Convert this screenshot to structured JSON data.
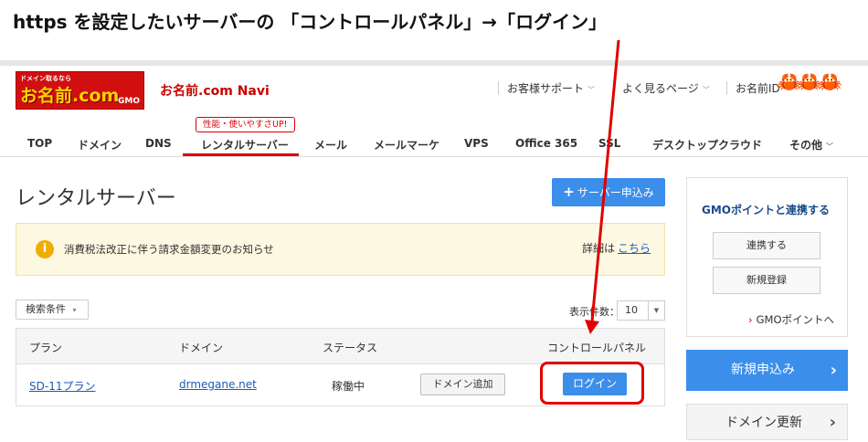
{
  "caption": "https を設定したいサーバーの 「コントロールパネル」→「ログイン」",
  "logo": {
    "tag": "ドメイン取るなら",
    "name": "お名前.com",
    "gmo": "GMO"
  },
  "header": {
    "site_name": "お名前.com Navi",
    "links": [
      "お客様サポート",
      "よく見るページ",
      "お名前ID"
    ]
  },
  "nav": {
    "badge": "性能・使いやすさUP!",
    "items": [
      "TOP",
      "ドメイン",
      "DNS",
      "レンタルサーバー",
      "メール",
      "メールマーケ",
      "VPS",
      "Office 365",
      "SSL",
      "デスクトップクラウド",
      "その他"
    ]
  },
  "main": {
    "title": "レンタルサーバー",
    "apply_button": "サーバー申込み",
    "notice": {
      "text": "消費税法改正に伴う請求金額変更のお知らせ",
      "more_label": "詳細は",
      "more_link": "こちら"
    },
    "filter_label": "検索条件",
    "per_page_label": "表示件数：",
    "per_page_value": "10"
  },
  "table": {
    "headers": [
      "プラン",
      "ドメイン",
      "ステータス",
      "コントロールパネル"
    ],
    "rows": [
      {
        "plan": "SD-11プラン",
        "domain": "drmegane.net",
        "status": "稼働中",
        "domain_add": "ドメイン追加",
        "login": "ログイン"
      }
    ]
  },
  "sidebar": {
    "title": "GMOポイントと連携する",
    "link_button": "連携する",
    "register_button": "新規登録",
    "points_link": "GMOポイントへ",
    "new_apply": "新規申込み",
    "domain_renew": "ドメイン更新"
  },
  "colors": {
    "brand_red": "#d20f0f",
    "primary_blue": "#3b8eea",
    "highlight_red": "#e00000"
  }
}
